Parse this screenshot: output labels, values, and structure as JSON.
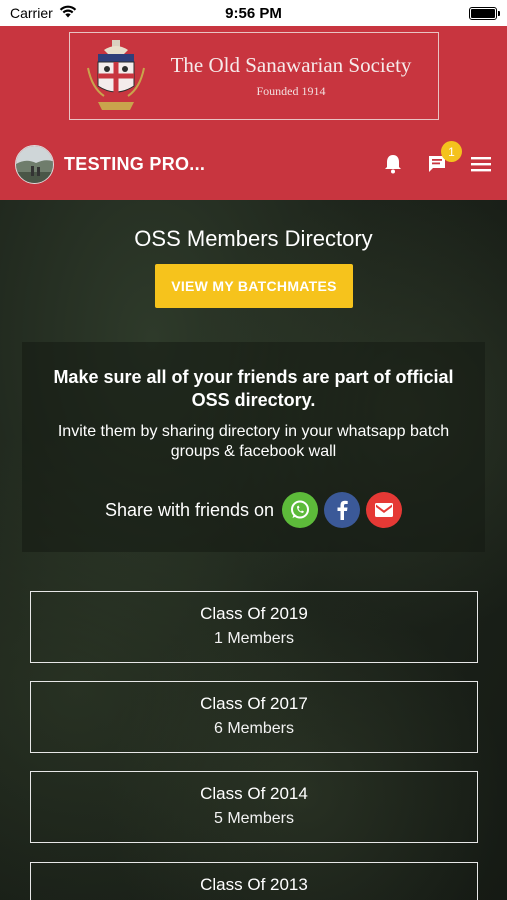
{
  "status_bar": {
    "carrier": "Carrier",
    "time": "9:56 PM"
  },
  "header": {
    "logo_title": "The Old Sanawarian Society",
    "logo_subtitle": "Founded 1914",
    "profile_name": "TESTING PRO...",
    "notifications_badge": "1",
    "brand_color": "#c8353f"
  },
  "directory": {
    "title": "OSS Members Directory",
    "view_batchmates_label": "VIEW MY BATCHMATES",
    "button_color": "#f6c31c"
  },
  "invite": {
    "heading": "Make sure all of your friends are part of official OSS directory.",
    "body": "Invite them by sharing directory in your whatsapp batch groups & facebook wall",
    "share_label": "Share with friends on",
    "share_buttons": [
      {
        "icon": "whatsapp-icon",
        "color": "#5dbb3a"
      },
      {
        "icon": "facebook-icon",
        "color": "#3b5998"
      },
      {
        "icon": "gmail-icon",
        "color": "#e53935"
      }
    ]
  },
  "classes": [
    {
      "name": "Class Of 2019",
      "members": "1 Members"
    },
    {
      "name": "Class Of 2017",
      "members": "6 Members"
    },
    {
      "name": "Class Of 2014",
      "members": "5 Members"
    },
    {
      "name": "Class Of 2013",
      "members": ""
    }
  ]
}
